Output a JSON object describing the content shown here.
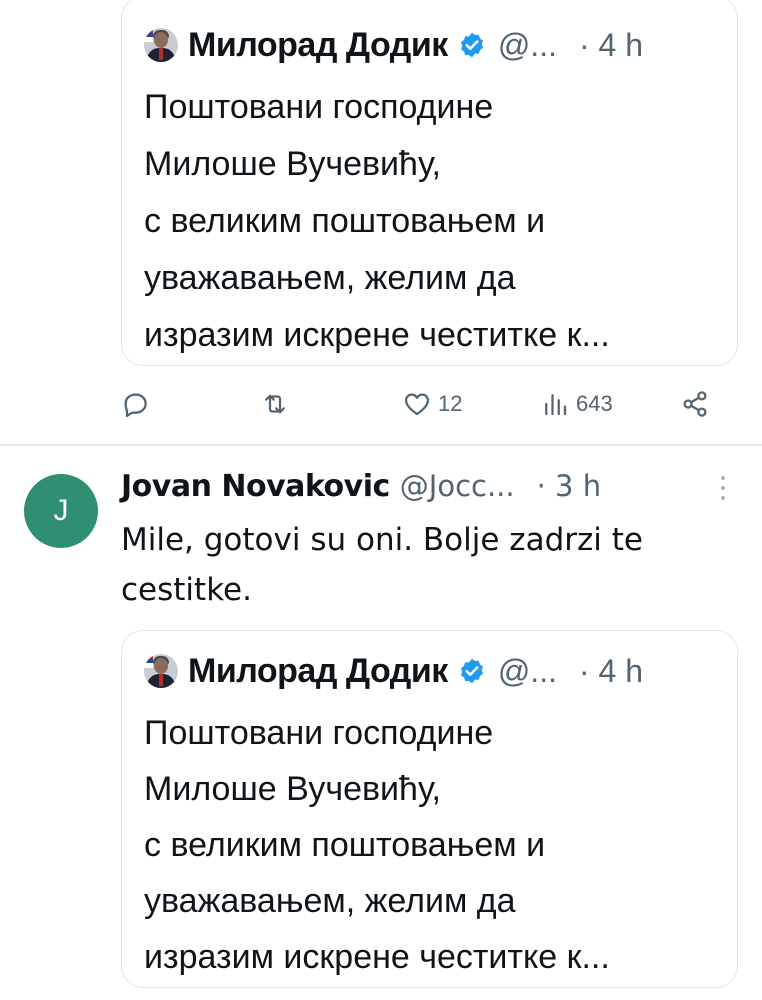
{
  "quoted_tweet": {
    "author_name": "Милорад Додик",
    "handle": "@...",
    "time": "· 4 h",
    "text_lines": [
      "Поштовани господине",
      "Милоше Вучевићу,",
      "с великим поштовањем и",
      "уважавањем, желим да",
      "изразим искрене честитке к..."
    ]
  },
  "actions": {
    "reply_icon": "reply-icon",
    "retweet_icon": "retweet-icon",
    "like_icon": "heart-icon",
    "like_count": "12",
    "views_icon": "views-icon",
    "views_count": "643",
    "share_icon": "share-icon"
  },
  "reply": {
    "avatar_letter": "J",
    "avatar_color": "#2e8f72",
    "author_name": "Jovan Novakovic",
    "handle": "@Jocc...",
    "time": "· 3 h",
    "text_lines": [
      "Mile, gotovi su oni. Bolje zadrzi te",
      "cestitke."
    ]
  },
  "colors": {
    "verified_blue": "#1d9bf0",
    "secondary_text": "#536471",
    "border": "#e1e6ea"
  }
}
